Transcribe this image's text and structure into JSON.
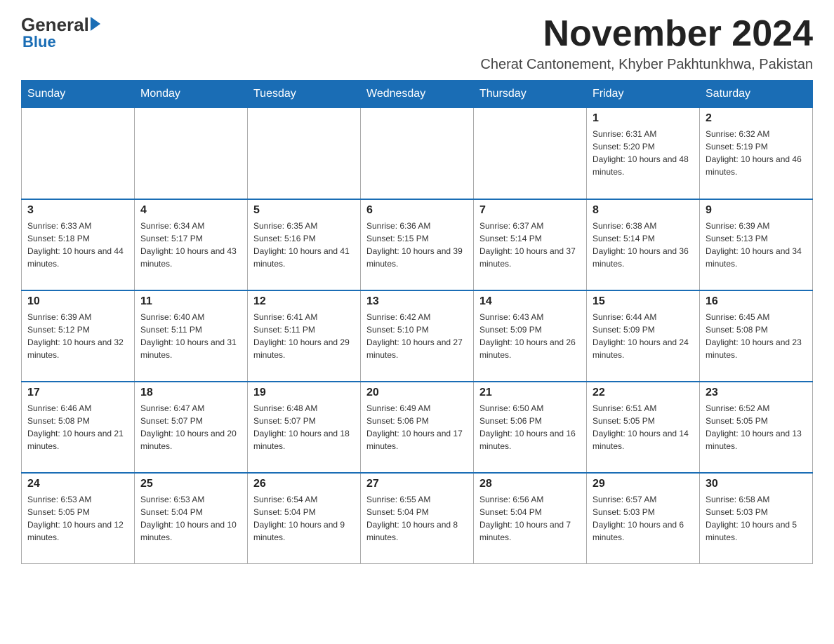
{
  "logo": {
    "general": "General",
    "blue": "Blue"
  },
  "header": {
    "month": "November 2024",
    "location": "Cherat Cantonement, Khyber Pakhtunkhwa, Pakistan"
  },
  "days": [
    "Sunday",
    "Monday",
    "Tuesday",
    "Wednesday",
    "Thursday",
    "Friday",
    "Saturday"
  ],
  "weeks": [
    [
      {
        "day": "",
        "sunrise": "",
        "sunset": "",
        "daylight": ""
      },
      {
        "day": "",
        "sunrise": "",
        "sunset": "",
        "daylight": ""
      },
      {
        "day": "",
        "sunrise": "",
        "sunset": "",
        "daylight": ""
      },
      {
        "day": "",
        "sunrise": "",
        "sunset": "",
        "daylight": ""
      },
      {
        "day": "",
        "sunrise": "",
        "sunset": "",
        "daylight": ""
      },
      {
        "day": "1",
        "sunrise": "Sunrise: 6:31 AM",
        "sunset": "Sunset: 5:20 PM",
        "daylight": "Daylight: 10 hours and 48 minutes."
      },
      {
        "day": "2",
        "sunrise": "Sunrise: 6:32 AM",
        "sunset": "Sunset: 5:19 PM",
        "daylight": "Daylight: 10 hours and 46 minutes."
      }
    ],
    [
      {
        "day": "3",
        "sunrise": "Sunrise: 6:33 AM",
        "sunset": "Sunset: 5:18 PM",
        "daylight": "Daylight: 10 hours and 44 minutes."
      },
      {
        "day": "4",
        "sunrise": "Sunrise: 6:34 AM",
        "sunset": "Sunset: 5:17 PM",
        "daylight": "Daylight: 10 hours and 43 minutes."
      },
      {
        "day": "5",
        "sunrise": "Sunrise: 6:35 AM",
        "sunset": "Sunset: 5:16 PM",
        "daylight": "Daylight: 10 hours and 41 minutes."
      },
      {
        "day": "6",
        "sunrise": "Sunrise: 6:36 AM",
        "sunset": "Sunset: 5:15 PM",
        "daylight": "Daylight: 10 hours and 39 minutes."
      },
      {
        "day": "7",
        "sunrise": "Sunrise: 6:37 AM",
        "sunset": "Sunset: 5:14 PM",
        "daylight": "Daylight: 10 hours and 37 minutes."
      },
      {
        "day": "8",
        "sunrise": "Sunrise: 6:38 AM",
        "sunset": "Sunset: 5:14 PM",
        "daylight": "Daylight: 10 hours and 36 minutes."
      },
      {
        "day": "9",
        "sunrise": "Sunrise: 6:39 AM",
        "sunset": "Sunset: 5:13 PM",
        "daylight": "Daylight: 10 hours and 34 minutes."
      }
    ],
    [
      {
        "day": "10",
        "sunrise": "Sunrise: 6:39 AM",
        "sunset": "Sunset: 5:12 PM",
        "daylight": "Daylight: 10 hours and 32 minutes."
      },
      {
        "day": "11",
        "sunrise": "Sunrise: 6:40 AM",
        "sunset": "Sunset: 5:11 PM",
        "daylight": "Daylight: 10 hours and 31 minutes."
      },
      {
        "day": "12",
        "sunrise": "Sunrise: 6:41 AM",
        "sunset": "Sunset: 5:11 PM",
        "daylight": "Daylight: 10 hours and 29 minutes."
      },
      {
        "day": "13",
        "sunrise": "Sunrise: 6:42 AM",
        "sunset": "Sunset: 5:10 PM",
        "daylight": "Daylight: 10 hours and 27 minutes."
      },
      {
        "day": "14",
        "sunrise": "Sunrise: 6:43 AM",
        "sunset": "Sunset: 5:09 PM",
        "daylight": "Daylight: 10 hours and 26 minutes."
      },
      {
        "day": "15",
        "sunrise": "Sunrise: 6:44 AM",
        "sunset": "Sunset: 5:09 PM",
        "daylight": "Daylight: 10 hours and 24 minutes."
      },
      {
        "day": "16",
        "sunrise": "Sunrise: 6:45 AM",
        "sunset": "Sunset: 5:08 PM",
        "daylight": "Daylight: 10 hours and 23 minutes."
      }
    ],
    [
      {
        "day": "17",
        "sunrise": "Sunrise: 6:46 AM",
        "sunset": "Sunset: 5:08 PM",
        "daylight": "Daylight: 10 hours and 21 minutes."
      },
      {
        "day": "18",
        "sunrise": "Sunrise: 6:47 AM",
        "sunset": "Sunset: 5:07 PM",
        "daylight": "Daylight: 10 hours and 20 minutes."
      },
      {
        "day": "19",
        "sunrise": "Sunrise: 6:48 AM",
        "sunset": "Sunset: 5:07 PM",
        "daylight": "Daylight: 10 hours and 18 minutes."
      },
      {
        "day": "20",
        "sunrise": "Sunrise: 6:49 AM",
        "sunset": "Sunset: 5:06 PM",
        "daylight": "Daylight: 10 hours and 17 minutes."
      },
      {
        "day": "21",
        "sunrise": "Sunrise: 6:50 AM",
        "sunset": "Sunset: 5:06 PM",
        "daylight": "Daylight: 10 hours and 16 minutes."
      },
      {
        "day": "22",
        "sunrise": "Sunrise: 6:51 AM",
        "sunset": "Sunset: 5:05 PM",
        "daylight": "Daylight: 10 hours and 14 minutes."
      },
      {
        "day": "23",
        "sunrise": "Sunrise: 6:52 AM",
        "sunset": "Sunset: 5:05 PM",
        "daylight": "Daylight: 10 hours and 13 minutes."
      }
    ],
    [
      {
        "day": "24",
        "sunrise": "Sunrise: 6:53 AM",
        "sunset": "Sunset: 5:05 PM",
        "daylight": "Daylight: 10 hours and 12 minutes."
      },
      {
        "day": "25",
        "sunrise": "Sunrise: 6:53 AM",
        "sunset": "Sunset: 5:04 PM",
        "daylight": "Daylight: 10 hours and 10 minutes."
      },
      {
        "day": "26",
        "sunrise": "Sunrise: 6:54 AM",
        "sunset": "Sunset: 5:04 PM",
        "daylight": "Daylight: 10 hours and 9 minutes."
      },
      {
        "day": "27",
        "sunrise": "Sunrise: 6:55 AM",
        "sunset": "Sunset: 5:04 PM",
        "daylight": "Daylight: 10 hours and 8 minutes."
      },
      {
        "day": "28",
        "sunrise": "Sunrise: 6:56 AM",
        "sunset": "Sunset: 5:04 PM",
        "daylight": "Daylight: 10 hours and 7 minutes."
      },
      {
        "day": "29",
        "sunrise": "Sunrise: 6:57 AM",
        "sunset": "Sunset: 5:03 PM",
        "daylight": "Daylight: 10 hours and 6 minutes."
      },
      {
        "day": "30",
        "sunrise": "Sunrise: 6:58 AM",
        "sunset": "Sunset: 5:03 PM",
        "daylight": "Daylight: 10 hours and 5 minutes."
      }
    ]
  ]
}
